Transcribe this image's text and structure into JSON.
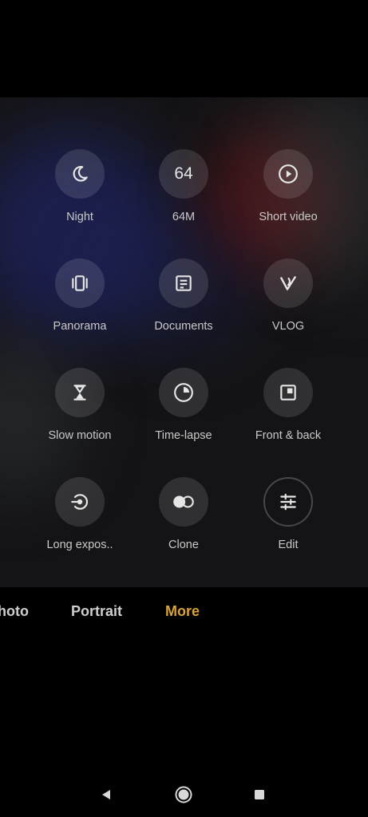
{
  "modes": [
    {
      "label": "Night",
      "icon": "moon-icon"
    },
    {
      "label": "64M",
      "icon": "64m-icon",
      "icon_text": "64"
    },
    {
      "label": "Short video",
      "icon": "play-circle-icon"
    },
    {
      "label": "Panorama",
      "icon": "panorama-icon"
    },
    {
      "label": "Documents",
      "icon": "document-icon"
    },
    {
      "label": "VLOG",
      "icon": "vlog-icon"
    },
    {
      "label": "Slow motion",
      "icon": "hourglass-icon"
    },
    {
      "label": "Time-lapse",
      "icon": "timelapse-icon"
    },
    {
      "label": "Front & back",
      "icon": "front-back-icon"
    },
    {
      "label": "Long expos..",
      "icon": "long-exposure-icon"
    },
    {
      "label": "Clone",
      "icon": "clone-icon"
    },
    {
      "label": "Edit",
      "icon": "sliders-icon"
    }
  ],
  "tabs": [
    {
      "label": "Photo",
      "visible_text": "hoto",
      "active": false
    },
    {
      "label": "Portrait",
      "active": false
    },
    {
      "label": "More",
      "active": true
    }
  ],
  "colors": {
    "accent": "#d9a33a",
    "icon": "#e6e6e6",
    "label": "#c9c9c9"
  },
  "navbar": [
    "back-icon",
    "home-icon",
    "recents-icon"
  ]
}
